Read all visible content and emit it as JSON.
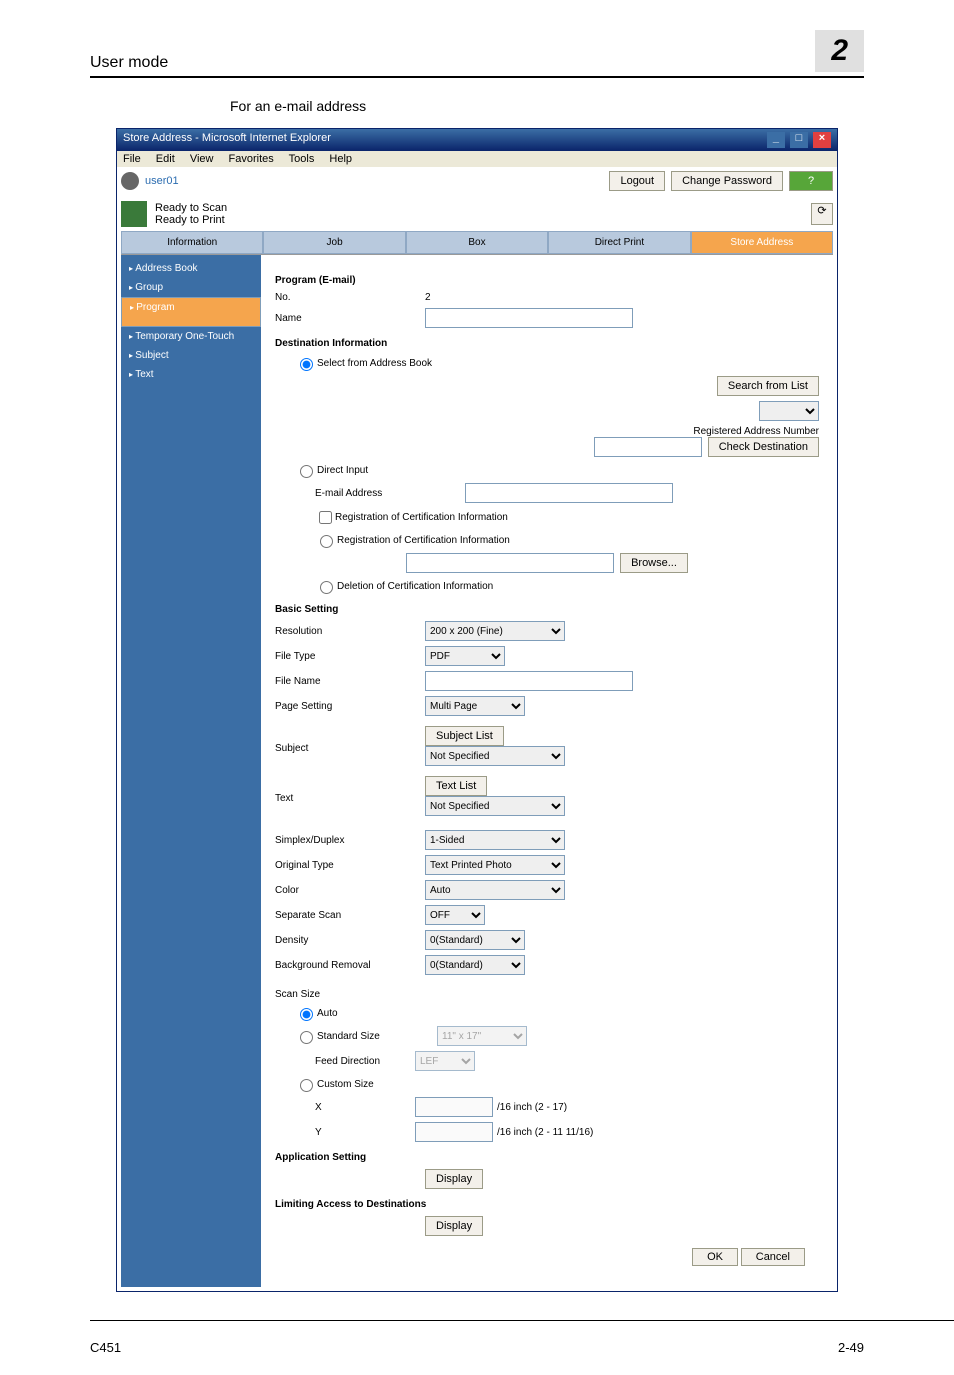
{
  "header": {
    "section": "User mode",
    "pagenum": "2"
  },
  "subtitle": "For an e-mail address",
  "window": {
    "title": "Store Address - Microsoft Internet Explorer"
  },
  "menu": [
    "File",
    "Edit",
    "View",
    "Favorites",
    "Tools",
    "Help"
  ],
  "user": "user01",
  "topbtns": {
    "logout": "Logout",
    "chpw": "Change Password",
    "help": "?"
  },
  "status": {
    "scan": "Ready to Scan",
    "print": "Ready to Print"
  },
  "tabs": [
    "Information",
    "Job",
    "Box",
    "Direct Print",
    "Store Address"
  ],
  "side": [
    "Address Book",
    "Group",
    "Program",
    "Temporary One-Touch",
    "Subject",
    "Text"
  ],
  "form": {
    "programTitle": "Program (E-mail)",
    "no": {
      "label": "No.",
      "value": "2"
    },
    "name": {
      "label": "Name",
      "value": ""
    },
    "destTitle": "Destination Information",
    "selAddr": "Select from Address Book",
    "searchList": "Search from List",
    "regNum": "Registered Address Number",
    "checkDest": "Check Destination",
    "directInput": "Direct Input",
    "emailAddr": "E-mail Address",
    "regCert": "Registration of Certification Information",
    "regCert2": "Registration of Certification Information",
    "browse": "Browse...",
    "delCert": "Deletion of Certification Information",
    "basicTitle": "Basic Setting",
    "resolution": {
      "label": "Resolution",
      "value": "200 x 200 (Fine)"
    },
    "filetype": {
      "label": "File Type",
      "value": "PDF"
    },
    "filename": {
      "label": "File Name",
      "value": ""
    },
    "pageset": {
      "label": "Page Setting",
      "value": "Multi Page"
    },
    "subject": {
      "label": "Subject",
      "btn": "Subject List",
      "value": "Not Specified"
    },
    "text": {
      "label": "Text",
      "btn": "Text List",
      "value": "Not Specified"
    },
    "simplex": {
      "label": "Simplex/Duplex",
      "value": "1-Sided"
    },
    "origtype": {
      "label": "Original Type",
      "value": "Text Printed Photo"
    },
    "color": {
      "label": "Color",
      "value": "Auto"
    },
    "sepscan": {
      "label": "Separate Scan",
      "value": "OFF"
    },
    "density": {
      "label": "Density",
      "value": "0(Standard)"
    },
    "bgremove": {
      "label": "Background Removal",
      "value": "0(Standard)"
    },
    "scansize": "Scan Size",
    "auto": "Auto",
    "stdsize": {
      "label": "Standard Size",
      "value": "11\" x 17\""
    },
    "feeddir": {
      "label": "Feed Direction",
      "value": "LEF"
    },
    "custsize": "Custom Size",
    "x": {
      "label": "X",
      "unit": "/16 inch (2 - 17)"
    },
    "y": {
      "label": "Y",
      "unit": "/16 inch (2 - 11 11/16)"
    },
    "appset": "Application Setting",
    "display": "Display",
    "limitAccess": "Limiting Access to Destinations",
    "ok": "OK",
    "cancel": "Cancel"
  },
  "footer": {
    "l": "C451",
    "r": "2-49"
  }
}
